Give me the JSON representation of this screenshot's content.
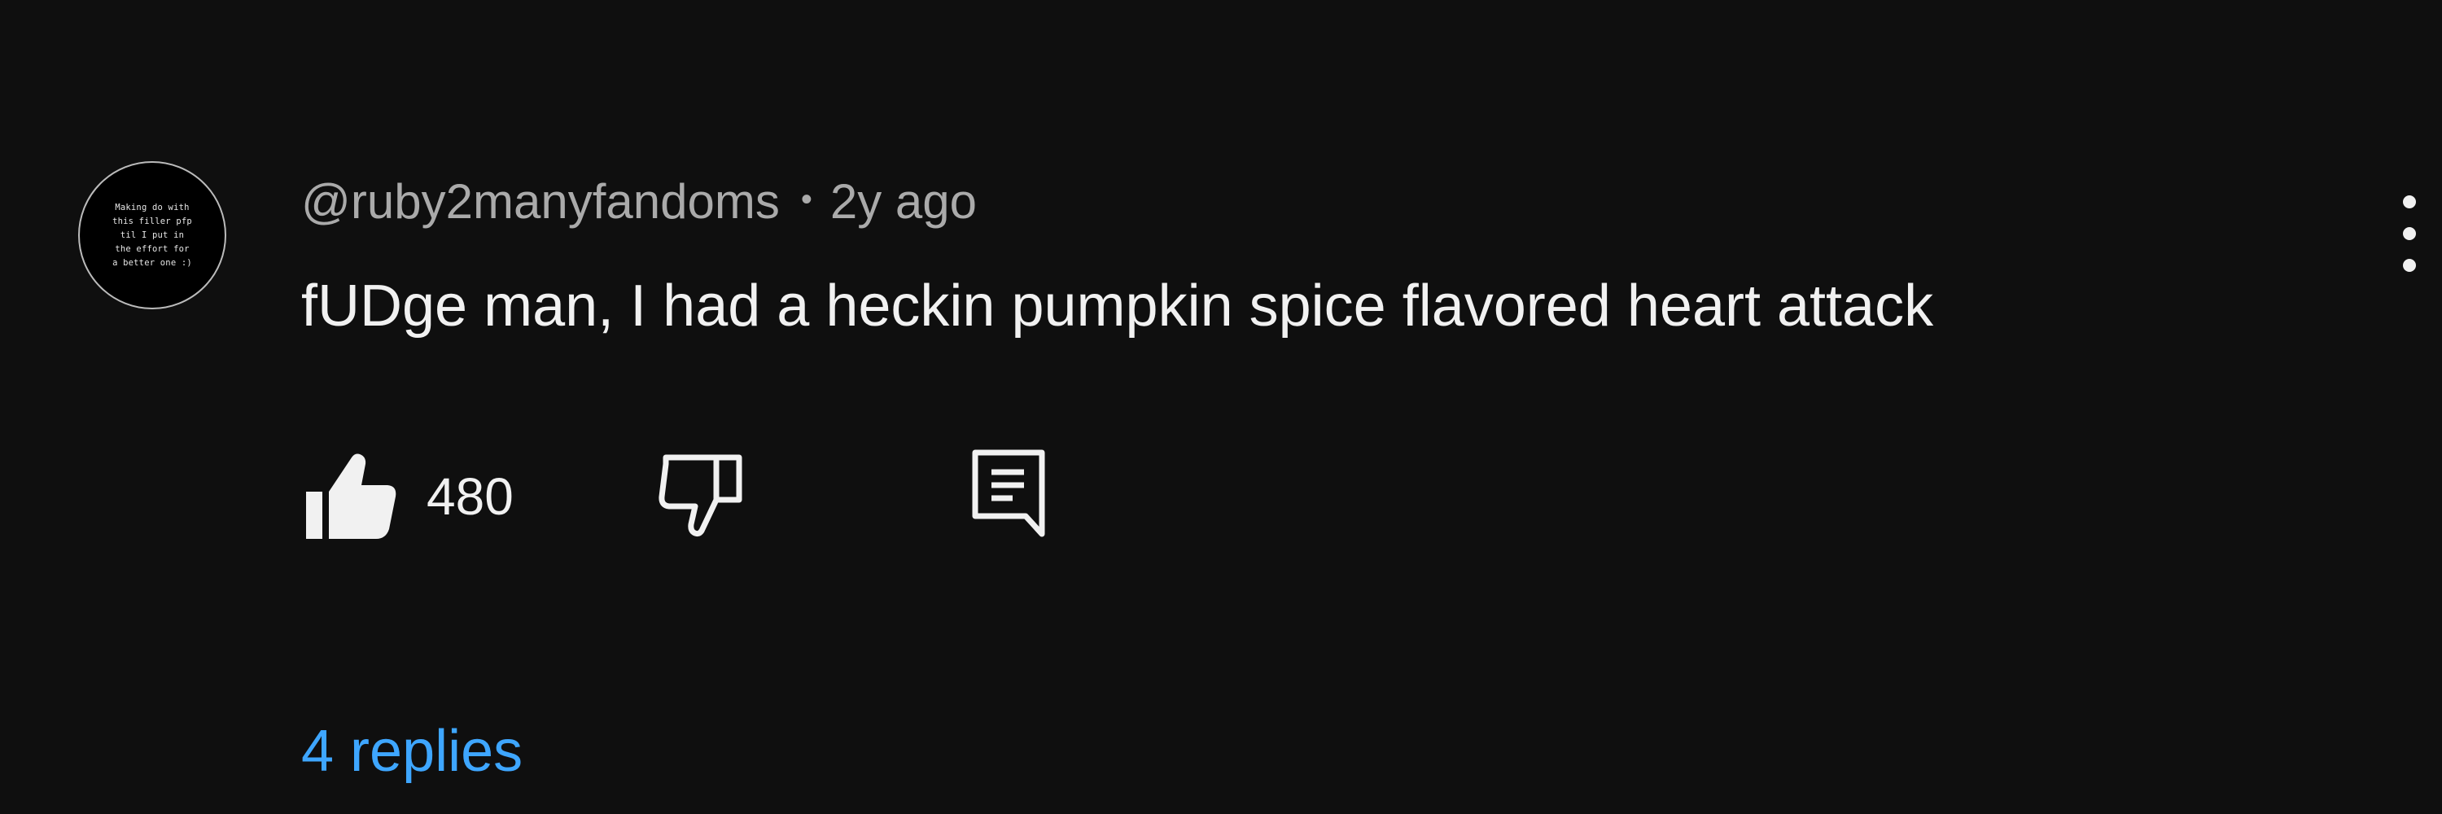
{
  "comment": {
    "avatar": {
      "text_lines": [
        "Making do with",
        "this filler pfp",
        "til I put in",
        "the effort for",
        "a better one :)"
      ]
    },
    "author": "@ruby2manyfandoms",
    "separator": "•",
    "time": "2y ago",
    "text": "fUDge man, I had a heckin pumpkin spice flavored heart attack",
    "like_count": "480",
    "replies_label": "4 replies",
    "icons": {
      "like": "thumbs-up-filled-icon",
      "dislike": "thumbs-down-outline-icon",
      "reply": "comment-icon",
      "more": "vertical-ellipsis-icon"
    },
    "colors": {
      "background": "#0f0f0f",
      "text": "#f1f1f1",
      "meta": "#aaaaaa",
      "link": "#3ea6ff"
    }
  }
}
